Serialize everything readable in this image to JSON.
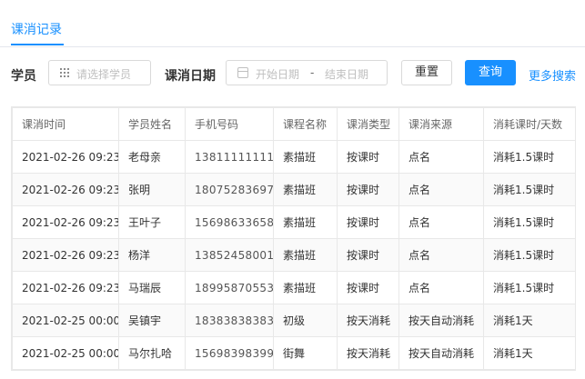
{
  "tabs": [
    {
      "label": "课消记录"
    }
  ],
  "filter": {
    "student_label": "学员",
    "student_placeholder": "请选择学员",
    "date_label": "课消日期",
    "start_placeholder": "开始日期",
    "separator": "-",
    "end_placeholder": "结束日期",
    "reset_label": "重置",
    "query_label": "查询",
    "more_label": "更多搜索"
  },
  "table": {
    "headers": [
      "课消时间",
      "学员姓名",
      "手机号码",
      "课程名称",
      "课消类型",
      "课消来源",
      "消耗课时/天数"
    ],
    "rows": [
      [
        "2021-02-26 09:23",
        "老母亲",
        "13811111111",
        "素描班",
        "按课时",
        "点名",
        "消耗1.5课时"
      ],
      [
        "2021-02-26 09:23",
        "张明",
        "18075283697",
        "素描班",
        "按课时",
        "点名",
        "消耗1.5课时"
      ],
      [
        "2021-02-26 09:23",
        "王叶子",
        "15698633658",
        "素描班",
        "按课时",
        "点名",
        "消耗1.5课时"
      ],
      [
        "2021-02-26 09:23",
        "杨洋",
        "13852458001",
        "素描班",
        "按课时",
        "点名",
        "消耗1.5课时"
      ],
      [
        "2021-02-26 09:23",
        "马瑞辰",
        "18995870553",
        "素描班",
        "按课时",
        "点名",
        "消耗1.5课时"
      ],
      [
        "2021-02-25 00:00",
        "吴镇宇",
        "18383838383",
        "初级",
        "按天消耗",
        "按天自动消耗",
        "消耗1天"
      ],
      [
        "2021-02-25 00:00",
        "马尔扎哈",
        "15698398399",
        "街舞",
        "按天消耗",
        "按天自动消耗",
        "消耗1天"
      ]
    ]
  }
}
